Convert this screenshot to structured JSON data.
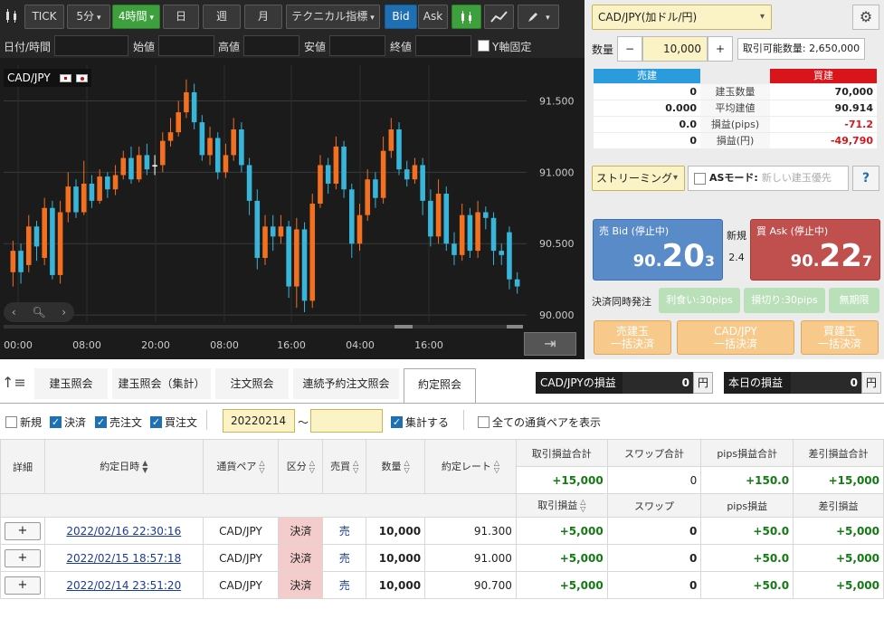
{
  "toolbar": {
    "tick": "TICK",
    "min5": "5分",
    "h4": "4時間",
    "day": "日",
    "week": "週",
    "month": "月",
    "technical": "テクニカル指標",
    "bid": "Bid",
    "ask": "Ask"
  },
  "filter": {
    "datetime": "日付/時間",
    "open": "始値",
    "high": "高値",
    "low": "安値",
    "close": "終値",
    "yfix": "Y軸固定"
  },
  "chart": {
    "pair_label": "CAD/JPY"
  },
  "chart_data": {
    "type": "candlestick",
    "y_ticks": [
      "91.500",
      "91.000",
      "90.500",
      "90.000"
    ],
    "x_ticks": [
      "00:00",
      "08:00",
      "20:00",
      "08:00",
      "16:00",
      "04:00",
      "16:00"
    ],
    "ylim": [
      89.95,
      91.75
    ],
    "candles": [
      {
        "o": 90.3,
        "c": 90.45,
        "h": 90.52,
        "l": 90.2
      },
      {
        "o": 90.45,
        "c": 90.3,
        "h": 90.5,
        "l": 90.22
      },
      {
        "o": 90.35,
        "c": 90.62,
        "h": 90.7,
        "l": 90.3
      },
      {
        "o": 90.62,
        "c": 90.48,
        "h": 90.66,
        "l": 90.38
      },
      {
        "o": 90.4,
        "c": 90.75,
        "h": 90.82,
        "l": 90.35
      },
      {
        "o": 90.75,
        "c": 90.28,
        "h": 90.8,
        "l": 90.25
      },
      {
        "o": 90.28,
        "c": 90.72,
        "h": 90.8,
        "l": 90.22
      },
      {
        "o": 90.72,
        "c": 90.9,
        "h": 91.0,
        "l": 90.65
      },
      {
        "o": 90.9,
        "c": 90.72,
        "h": 90.95,
        "l": 90.68
      },
      {
        "o": 90.72,
        "c": 90.92,
        "h": 91.08,
        "l": 90.7
      },
      {
        "o": 90.92,
        "c": 90.8,
        "h": 90.98,
        "l": 90.75
      },
      {
        "o": 90.8,
        "c": 90.97,
        "h": 91.02,
        "l": 90.78
      },
      {
        "o": 90.97,
        "c": 90.88,
        "h": 91.0,
        "l": 90.82
      },
      {
        "o": 90.88,
        "c": 90.98,
        "h": 91.05,
        "l": 90.84
      },
      {
        "o": 90.98,
        "c": 91.1,
        "h": 91.15,
        "l": 90.95
      },
      {
        "o": 91.1,
        "c": 90.95,
        "h": 91.18,
        "l": 90.92
      },
      {
        "o": 90.95,
        "c": 91.12,
        "h": 91.18,
        "l": 90.93
      },
      {
        "o": 91.12,
        "c": 91.02,
        "h": 91.2,
        "l": 90.98
      },
      {
        "o": 91.05,
        "c": 91.05,
        "h": 91.12,
        "l": 90.98
      },
      {
        "o": 91.05,
        "c": 91.22,
        "h": 91.28,
        "l": 91.0
      },
      {
        "o": 91.22,
        "c": 91.28,
        "h": 91.38,
        "l": 91.18
      },
      {
        "o": 91.28,
        "c": 91.42,
        "h": 91.5,
        "l": 91.25
      },
      {
        "o": 91.42,
        "c": 91.56,
        "h": 91.65,
        "l": 91.38
      },
      {
        "o": 91.56,
        "c": 91.35,
        "h": 91.62,
        "l": 91.3
      },
      {
        "o": 91.35,
        "c": 91.12,
        "h": 91.4,
        "l": 91.08
      },
      {
        "o": 91.12,
        "c": 91.24,
        "h": 91.32,
        "l": 91.05
      },
      {
        "o": 91.24,
        "c": 91.0,
        "h": 91.28,
        "l": 90.95
      },
      {
        "o": 91.0,
        "c": 91.12,
        "h": 91.2,
        "l": 90.96
      },
      {
        "o": 91.12,
        "c": 91.3,
        "h": 91.38,
        "l": 91.08
      },
      {
        "o": 91.3,
        "c": 91.05,
        "h": 91.35,
        "l": 91.0
      },
      {
        "o": 91.05,
        "c": 90.8,
        "h": 91.1,
        "l": 90.7
      },
      {
        "o": 90.8,
        "c": 90.4,
        "h": 90.88,
        "l": 90.32
      },
      {
        "o": 90.4,
        "c": 90.62,
        "h": 90.7,
        "l": 90.35
      },
      {
        "o": 90.62,
        "c": 90.55,
        "h": 90.7,
        "l": 90.45
      },
      {
        "o": 90.55,
        "c": 90.62,
        "h": 90.7,
        "l": 90.5
      },
      {
        "o": 90.62,
        "c": 90.2,
        "h": 90.66,
        "l": 90.12
      },
      {
        "o": 90.2,
        "c": 90.6,
        "h": 90.68,
        "l": 90.05
      },
      {
        "o": 90.6,
        "c": 90.1,
        "h": 90.65,
        "l": 90.02
      },
      {
        "o": 90.1,
        "c": 90.78,
        "h": 90.85,
        "l": 90.05
      },
      {
        "o": 90.78,
        "c": 91.05,
        "h": 91.12,
        "l": 90.75
      },
      {
        "o": 91.05,
        "c": 90.92,
        "h": 91.1,
        "l": 90.85
      },
      {
        "o": 90.92,
        "c": 91.18,
        "h": 91.25,
        "l": 90.88
      },
      {
        "o": 91.18,
        "c": 90.88,
        "h": 91.22,
        "l": 90.82
      },
      {
        "o": 90.88,
        "c": 90.5,
        "h": 90.92,
        "l": 90.4
      },
      {
        "o": 90.5,
        "c": 90.7,
        "h": 90.78,
        "l": 90.45
      },
      {
        "o": 90.7,
        "c": 90.95,
        "h": 91.02,
        "l": 90.66
      },
      {
        "o": 90.95,
        "c": 90.82,
        "h": 91.0,
        "l": 90.75
      },
      {
        "o": 90.82,
        "c": 91.15,
        "h": 91.25,
        "l": 90.78
      },
      {
        "o": 91.15,
        "c": 91.3,
        "h": 91.38,
        "l": 91.1
      },
      {
        "o": 91.3,
        "c": 91.02,
        "h": 91.35,
        "l": 90.98
      },
      {
        "o": 91.02,
        "c": 90.95,
        "h": 91.08,
        "l": 90.9
      },
      {
        "o": 90.95,
        "c": 91.05,
        "h": 91.1,
        "l": 90.92
      },
      {
        "o": 91.05,
        "c": 90.8,
        "h": 91.1,
        "l": 90.7
      },
      {
        "o": 90.8,
        "c": 90.55,
        "h": 90.88,
        "l": 90.48
      },
      {
        "o": 90.55,
        "c": 90.85,
        "h": 90.95,
        "l": 90.5
      },
      {
        "o": 90.85,
        "c": 90.5,
        "h": 90.9,
        "l": 90.45
      },
      {
        "o": 90.5,
        "c": 90.42,
        "h": 90.58,
        "l": 90.35
      },
      {
        "o": 90.42,
        "c": 90.7,
        "h": 90.78,
        "l": 90.38
      },
      {
        "o": 90.7,
        "c": 90.45,
        "h": 90.75,
        "l": 90.4
      },
      {
        "o": 90.45,
        "c": 90.72,
        "h": 90.8,
        "l": 90.4
      },
      {
        "o": 90.72,
        "c": 90.68,
        "h": 90.76,
        "l": 90.6
      },
      {
        "o": 90.68,
        "c": 90.45,
        "h": 90.72,
        "l": 90.35
      },
      {
        "o": 90.45,
        "c": 90.42,
        "h": 90.5,
        "l": 90.35
      },
      {
        "o": 90.58,
        "c": 90.25,
        "h": 90.62,
        "l": 90.18
      },
      {
        "o": 90.25,
        "c": 90.2,
        "h": 90.3,
        "l": 90.15
      }
    ],
    "up_color": "#f27020",
    "down_color": "#39b5d9",
    "grid": true
  },
  "rate_panel": {
    "pair_select": "CAD/JPY(加ドル/円)",
    "qty_label": "数量",
    "minus": "−",
    "qty_value": "10,000",
    "plus": "+",
    "tradable": "取引可能数量: 2,650,000",
    "sell_head": "売建",
    "buy_head": "買建",
    "rows": [
      {
        "label": "建玉数量",
        "sell": "0",
        "buy": "70,000"
      },
      {
        "label": "平均建値",
        "sell": "0.000",
        "buy": "90.914"
      },
      {
        "label": "損益(pips)",
        "sell": "0.0",
        "buy": "-71.2"
      },
      {
        "label": "損益(円)",
        "sell": "0",
        "buy": "-49,790"
      }
    ],
    "streaming": "ストリーミング",
    "as_mode": "ASモード:",
    "as_mode_value": "新しい建玉優先",
    "help": "?",
    "bid_label": "売 Bid (停止中)",
    "bid_main": "90.",
    "bid_big": "20",
    "bid_small": "3",
    "spread_label": "新規",
    "spread": "2.4",
    "ask_label": "買 Ask (停止中)",
    "ask_main": "90.",
    "ask_big": "22",
    "ask_small": "7",
    "settle_label": "決済同時発注",
    "take_profit": "利食い:30pips",
    "stop_loss": "損切り:30pips",
    "expiry": "無期限",
    "bulk_sell_1": "売建玉",
    "bulk_sell_2": "一括決済",
    "bulk_pair_1": "CAD/JPY",
    "bulk_pair_2": "一括決済",
    "bulk_buy_1": "買建玉",
    "bulk_buy_2": "一括決済"
  },
  "tabs": [
    "建玉照会",
    "建玉照会（集計）",
    "注文照会",
    "連続予約注文照会",
    "約定照会"
  ],
  "pnl": {
    "pair_label": "CAD/JPYの損益",
    "pair_value": "0",
    "today_label": "本日の損益",
    "today_value": "0",
    "unit": "円"
  },
  "filters2": {
    "new": "新規",
    "settle": "決済",
    "sell_order": "売注文",
    "buy_order": "買注文",
    "date_from": "20220214",
    "tilde": "〜",
    "aggregate": "集計する",
    "show_all": "全ての通貨ペアを表示"
  },
  "grid": {
    "headers": {
      "detail": "詳細",
      "date": "約定日時",
      "pair": "通貨ペア",
      "kind": "区分",
      "side": "売買",
      "qty": "数量",
      "rate": "約定レート",
      "trade_total": "取引損益合計",
      "swap_total": "スワップ合計",
      "pips_total": "pips損益合計",
      "net_total": "差引損益合計",
      "trade": "取引損益",
      "swap": "スワップ",
      "pips": "pips損益",
      "net": "差引損益"
    },
    "totals": {
      "trade": "+15,000",
      "swap": "0",
      "pips": "+150.0",
      "net": "+15,000"
    },
    "rows": [
      {
        "btn": "+",
        "date": "2022/02/16 22:30:16",
        "pair": "CAD/JPY",
        "kind": "決済",
        "side": "売",
        "qty": "10,000",
        "rate": "91.300",
        "trade": "+5,000",
        "swap": "0",
        "pips": "+50.0",
        "net": "+5,000"
      },
      {
        "btn": "+",
        "date": "2022/02/15 18:57:18",
        "pair": "CAD/JPY",
        "kind": "決済",
        "side": "売",
        "qty": "10,000",
        "rate": "91.000",
        "trade": "+5,000",
        "swap": "0",
        "pips": "+50.0",
        "net": "+5,000"
      },
      {
        "btn": "+",
        "date": "2022/02/14 23:51:20",
        "pair": "CAD/JPY",
        "kind": "決済",
        "side": "売",
        "qty": "10,000",
        "rate": "90.700",
        "trade": "+5,000",
        "swap": "0",
        "pips": "+50.0",
        "net": "+5,000"
      }
    ]
  }
}
